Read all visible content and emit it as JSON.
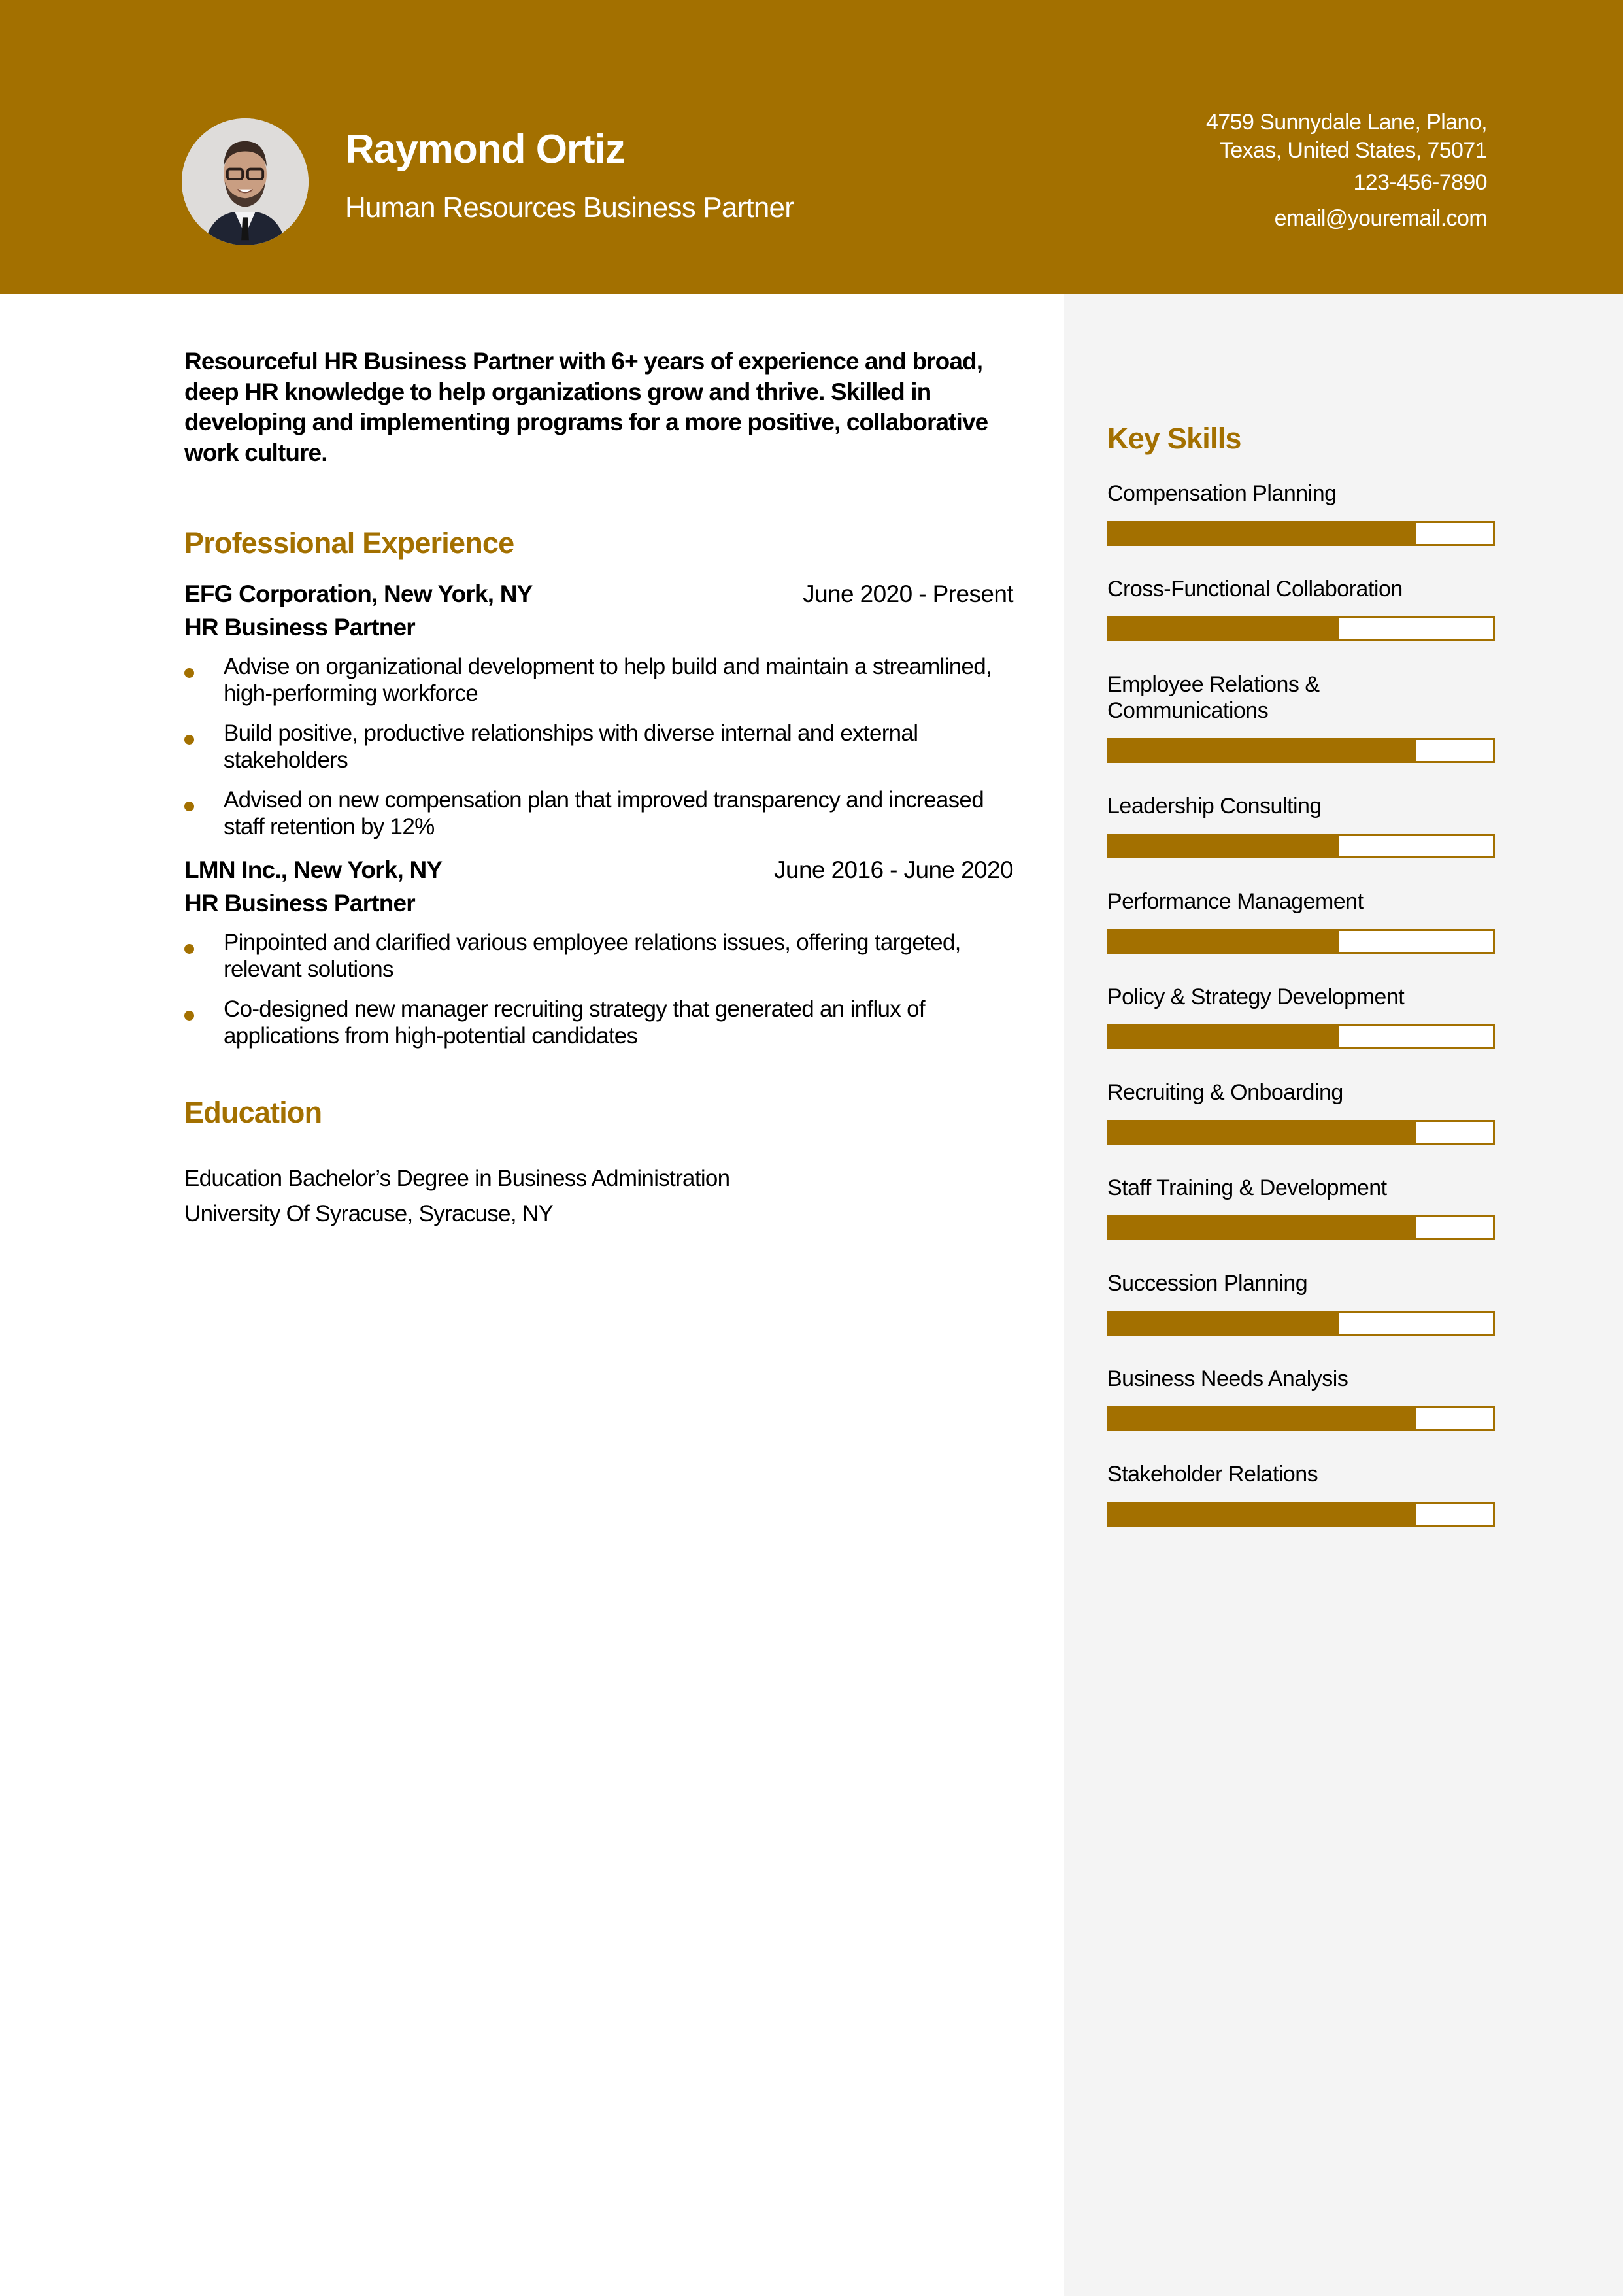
{
  "header": {
    "name": "Raymond Ortiz",
    "title": "Human Resources Business Partner",
    "photo": "profile-photo",
    "contact": {
      "address_line1": "4759 Sunnydale Lane, Plano,",
      "address_line2": "Texas, United States, 75071",
      "phone": "123-456-7890",
      "email": "email@youremail.com"
    }
  },
  "theme": {
    "accent": "#A37000",
    "sidebar_bg": "#F4F4F4",
    "text": "#000000"
  },
  "summary": "Resourceful HR Business Partner with 6+ years of experience and broad,  deep HR knowledge to help organizations grow and thrive. Skilled in  developing and implementing programs for a more positive, collaborative  work culture.",
  "experience": {
    "heading": "Professional Experience",
    "jobs": [
      {
        "company": "EFG Corporation, New York, NY",
        "dates": "June 2020 - Present",
        "role": "HR Business Partner",
        "bullets": [
          "Advise on organizational development to help build and maintain a streamlined, high-performing workforce",
          "Build positive, productive relationships with diverse internal and external stakeholders",
          "Advised on new compensation plan that improved transparency and increased staff retention by 12%"
        ]
      },
      {
        "company": "LMN Inc., New York, NY",
        "dates": "June 2016 - June 2020",
        "role": "HR Business Partner",
        "bullets": [
          "Pinpointed and clarified various employee relations issues, offering targeted, relevant solutions",
          "Co-designed new manager recruiting strategy that generated an influx of applications from high-potential candidates"
        ]
      }
    ]
  },
  "education": {
    "heading": "Education",
    "degree": "Education Bachelor’s Degree in Business Administration",
    "school": "University Of Syracuse, Syracuse, NY"
  },
  "skills": {
    "heading": "Key Skills",
    "items": [
      {
        "label": "Compensation Planning",
        "level": 0.8
      },
      {
        "label": "Cross-Functional Collaboration",
        "level": 0.6
      },
      {
        "label": "Employee Relations & Communications",
        "level": 0.8
      },
      {
        "label": "Leadership Consulting",
        "level": 0.6
      },
      {
        "label": "Performance Management",
        "level": 0.6
      },
      {
        "label": "Policy & Strategy Development",
        "level": 0.6
      },
      {
        "label": "Recruiting & Onboarding",
        "level": 0.8
      },
      {
        "label": "Staff Training & Development",
        "level": 0.8
      },
      {
        "label": "Succession Planning",
        "level": 0.6
      },
      {
        "label": "Business Needs Analysis",
        "level": 0.8
      },
      {
        "label": "Stakeholder Relations",
        "level": 0.8
      }
    ]
  }
}
